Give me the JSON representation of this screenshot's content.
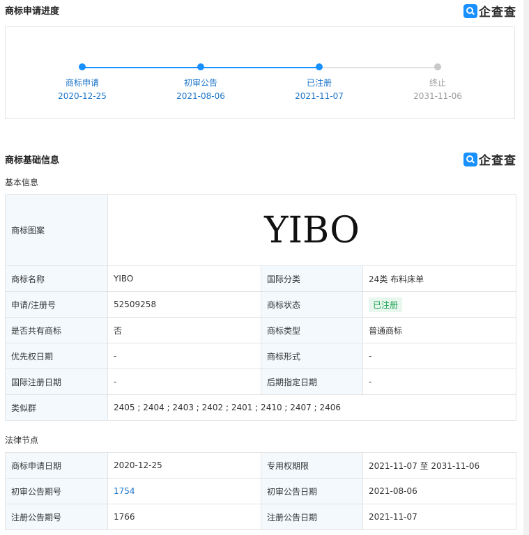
{
  "progress": {
    "title": "商标申请进度",
    "steps": [
      {
        "label": "商标申请",
        "date": "2020-12-25"
      },
      {
        "label": "初审公告",
        "date": "2021-08-06"
      },
      {
        "label": "已注册",
        "date": "2021-11-07"
      },
      {
        "label": "终止",
        "date": "2031-11-06"
      }
    ]
  },
  "logo": {
    "text": "企查查"
  },
  "basic": {
    "title": "商标基础信息",
    "subtitle": "基本信息",
    "image_label": "商标图案",
    "image_text": "YIBO",
    "rows": [
      {
        "l1": "商标名称",
        "v1": "YIBO",
        "l2": "国际分类",
        "v2": "24类 布料床单"
      },
      {
        "l1": "申请/注册号",
        "v1": "52509258",
        "l2": "商标状态",
        "v2": "已注册"
      },
      {
        "l1": "是否共有商标",
        "v1": "否",
        "l2": "商标类型",
        "v2": "普通商标"
      },
      {
        "l1": "优先权日期",
        "v1": "-",
        "l2": "商标形式",
        "v2": "-"
      },
      {
        "l1": "国际注册日期",
        "v1": "-",
        "l2": "后期指定日期",
        "v2": "-"
      }
    ],
    "similar_label": "类似群",
    "similar_value": "2405 ; 2404 ; 2403 ; 2402 ; 2401 ; 2410 ; 2407 ; 2406"
  },
  "legal": {
    "subtitle": "法律节点",
    "rows": [
      {
        "l1": "商标申请日期",
        "v1": "2020-12-25",
        "l2": "专用权期限",
        "v2": "2021-11-07 至 2031-11-06"
      },
      {
        "l1": "初审公告期号",
        "v1": "1754",
        "l2": "初审公告日期",
        "v2": "2021-08-06"
      },
      {
        "l1": "注册公告期号",
        "v1": "1766",
        "l2": "注册公告日期",
        "v2": "2021-11-07"
      }
    ]
  },
  "colors": {
    "active": "#1890ff",
    "inactive": "#c8c8c8",
    "active_text": "#1a73c9",
    "inactive_text": "#999999"
  }
}
